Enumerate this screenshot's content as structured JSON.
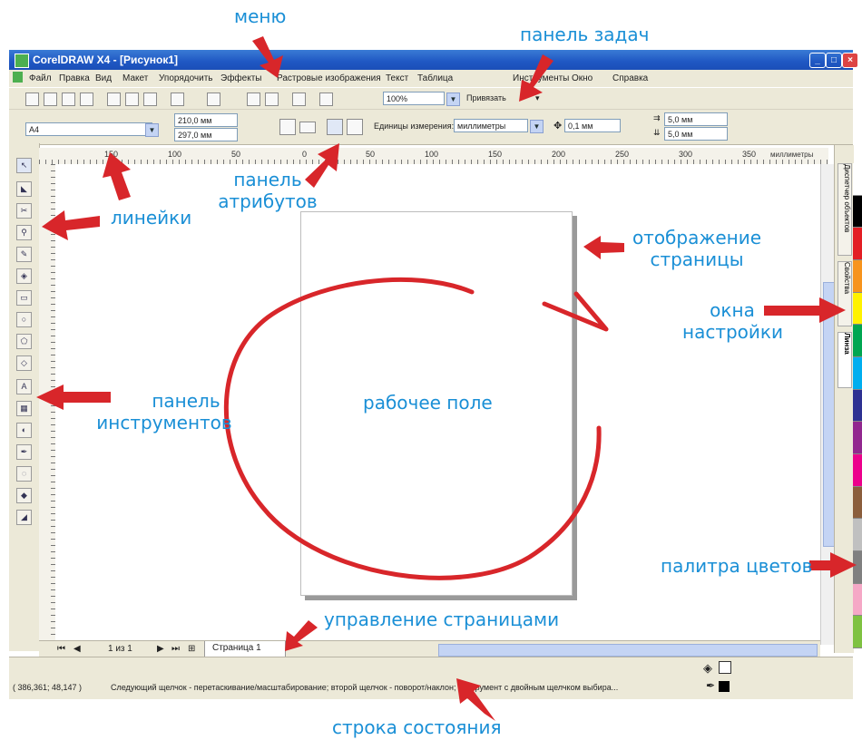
{
  "annotations": {
    "menu": "меню",
    "taskbar": "панель задач",
    "attributes": [
      "панель",
      "атрибутов"
    ],
    "rulers": "линейки",
    "page_view": [
      "отображение",
      "страницы"
    ],
    "dockers": [
      "окна",
      "настройки"
    ],
    "workspace": "рабочее поле",
    "toolbox": [
      "панель",
      "инструментов"
    ],
    "palette": "палитра цветов",
    "page_control": "управление страницами",
    "statusbar": "строка состояния"
  },
  "window": {
    "title": "CorelDRAW X4 - [Рисунок1]",
    "min": "_",
    "max": "□",
    "close": "×"
  },
  "menu": [
    "Файл",
    "Правка",
    "Вид",
    "Макет",
    "Упорядочить",
    "Эффекты",
    "Растровые изображения",
    "Текст",
    "Таблица",
    "Инструменты",
    "Окно",
    "Справка"
  ],
  "toolbar1": {
    "zoom": "100%",
    "snap": "Привязать"
  },
  "toolbar2": {
    "paper": "A4",
    "width": "210,0 мм",
    "height": "297,0 мм",
    "units_label": "Единицы измерения:",
    "units": "миллиметры",
    "nudge": "0,1 мм",
    "dup_x": "5,0 мм",
    "dup_y": "5,0 мм"
  },
  "ruler": {
    "ticks": [
      "150",
      "100",
      "50",
      "0",
      "50",
      "100",
      "150",
      "200",
      "250",
      "300",
      "350"
    ],
    "unit": "миллиметры"
  },
  "dockers": [
    "Диспетчер объектов",
    "Свойства",
    "Линза"
  ],
  "pagebar": {
    "counter": "1 из 1",
    "tab": "Страница 1"
  },
  "status": {
    "coords": "( 386,361; 48,147 )",
    "hint": "Следующий щелчок - перетаскивание/масштабирование; второй щелчок - поворот/наклон; инструмент с двойным щелчком выбира..."
  },
  "colors": {
    "annotation": "#1a8fd6",
    "arrow": "#d8262a",
    "titlebar": "#1f57c3",
    "chrome": "#ece9d8",
    "palette": [
      "#ffffff",
      "#000000",
      "#e31e24",
      "#f7941d",
      "#fff200",
      "#00a651",
      "#00aeef",
      "#2e3192",
      "#92278f",
      "#ec008c",
      "#8b5e3c",
      "#c0c0c0",
      "#808080",
      "#f5a8c6",
      "#7fc241"
    ]
  }
}
